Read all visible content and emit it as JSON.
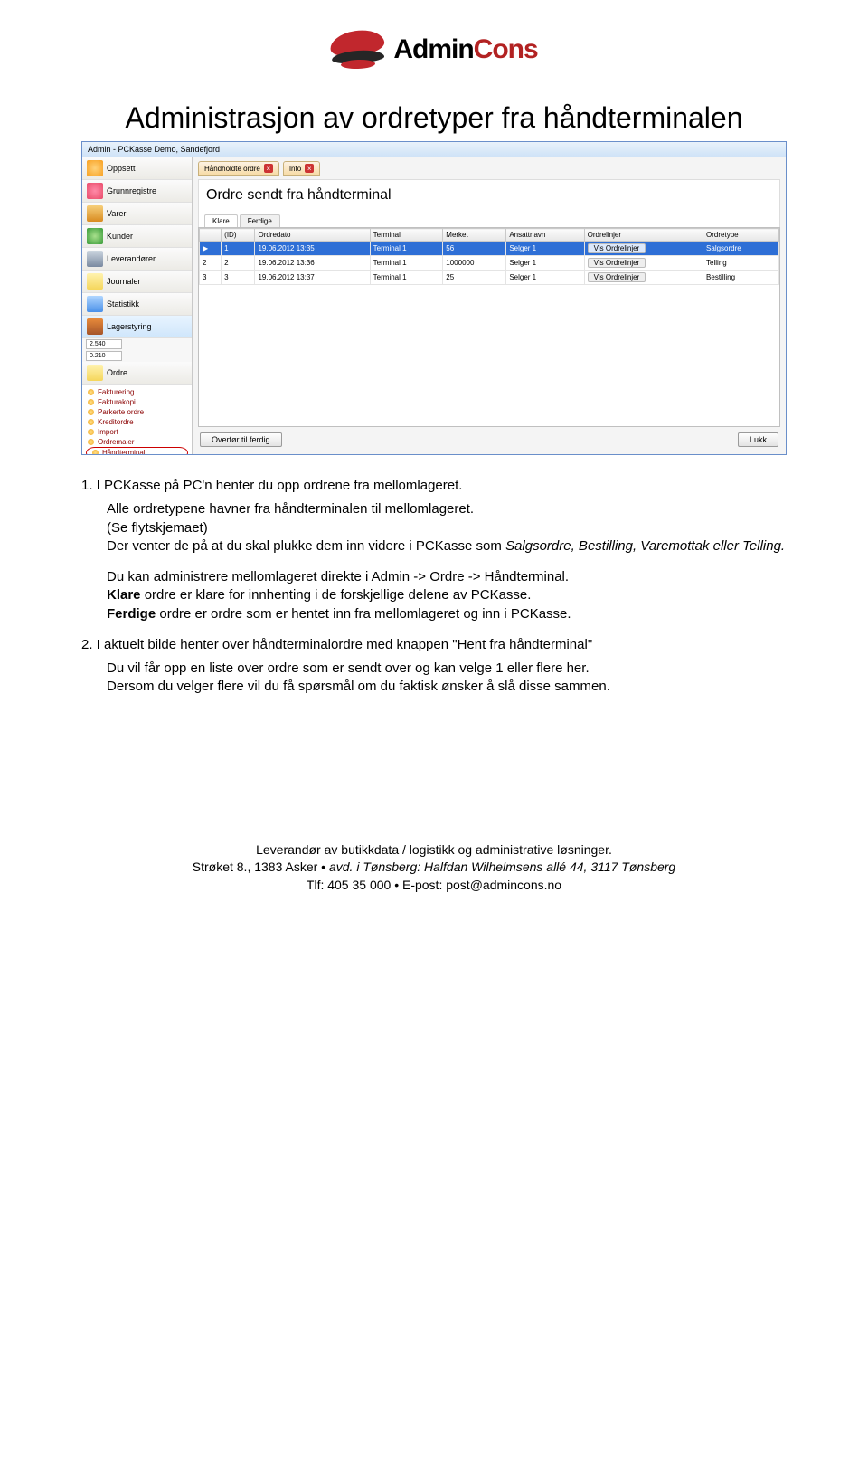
{
  "logo": {
    "brand_a": "Admin",
    "brand_b": "Cons"
  },
  "title": "Administrasjon av ordretyper fra håndterminalen",
  "app": {
    "titlebar": "Admin - PCKasse Demo, Sandefjord",
    "sidebar": {
      "items": [
        "Oppsett",
        "Grunnregistre",
        "Varer",
        "Kunder",
        "Leverandører",
        "Journaler",
        "Statistikk",
        "Lagerstyring"
      ],
      "tiny1": "2.540",
      "tiny2": "0.210",
      "ordre_label": "Ordre",
      "sub": [
        "Fakturering",
        "Fakturakopi",
        "Parkerte ordre",
        "Kreditordre",
        "Import",
        "Ordremaler",
        "Håndterminal"
      ]
    },
    "tabs": {
      "t1": "Håndholdte ordre",
      "t2": "Info"
    },
    "panel_heading": "Ordre sendt fra håndterminal",
    "subtabs": {
      "a": "Klare",
      "b": "Ferdige"
    },
    "grid": {
      "headers": [
        "",
        "(ID)",
        "Ordredato",
        "Terminal",
        "Merket",
        "Ansattnavn",
        "Ordrelinjer",
        "Ordretype"
      ],
      "rows": [
        {
          "ptr": "▶",
          "id": "1",
          "date": "19.06.2012 13:35",
          "term": "Terminal 1",
          "mark": "56",
          "emp": "Selger 1",
          "btn": "Vis Ordrelinjer",
          "type": "Salgsordre",
          "sel": true
        },
        {
          "ptr": "2",
          "id": "2",
          "date": "19.06.2012 13:36",
          "term": "Terminal 1",
          "mark": "1000000",
          "emp": "Selger 1",
          "btn": "Vis Ordrelinjer",
          "type": "Telling",
          "sel": false
        },
        {
          "ptr": "3",
          "id": "3",
          "date": "19.06.2012 13:37",
          "term": "Terminal 1",
          "mark": "25",
          "emp": "Selger 1",
          "btn": "Vis Ordrelinjer",
          "type": "Bestilling",
          "sel": false
        }
      ]
    },
    "btn_transfer": "Overfør til ferdig",
    "btn_close": "Lukk"
  },
  "body": {
    "n1_a": "1.   I PCKasse på PC'n henter du opp ordrene fra mellomlageret.",
    "n1_b": "Alle ordretypene havner fra håndterminalen til mellomlageret.",
    "n1_c_a": "(Se flytskjemaet)",
    "n1_c_b": "Der venter de på at du skal plukke dem inn videre i PCKasse som ",
    "n1_c_c": "Salgsordre, Bestilling, Varemottak eller Telling.",
    "p2": "Du kan administrere mellomlageret direkte i Admin -> Ordre -> Håndterminal.",
    "p3a": "Klare",
    "p3b": " ordre er klare for innhenting i de forskjellige delene av PCKasse.",
    "p4a": "Ferdige",
    "p4b": " ordre er ordre som er hentet inn fra mellomlageret og inn i  PCKasse.",
    "n2_a": "2.   I aktuelt bilde henter over håndterminalordre med knappen \"Hent fra håndterminal\"",
    "n2_b": "Du vil får opp en liste over ordre som er sendt over og kan velge 1 eller flere her.",
    "n2_c": "Dersom du velger flere vil du få spørsmål om du faktisk ønsker å slå disse sammen."
  },
  "footer": {
    "l1": "Leverandør av butikkdata / logistikk og administrative løsninger.",
    "l2a": "Strøket 8., 1383 Asker ",
    "l2b": "avd. i Tønsberg: ",
    "l2c": "Halfdan Wilhelmsens allé 44, 3117 Tønsberg",
    "l3": "Tlf: 405 35 000 • E-post: post@admincons.no"
  }
}
